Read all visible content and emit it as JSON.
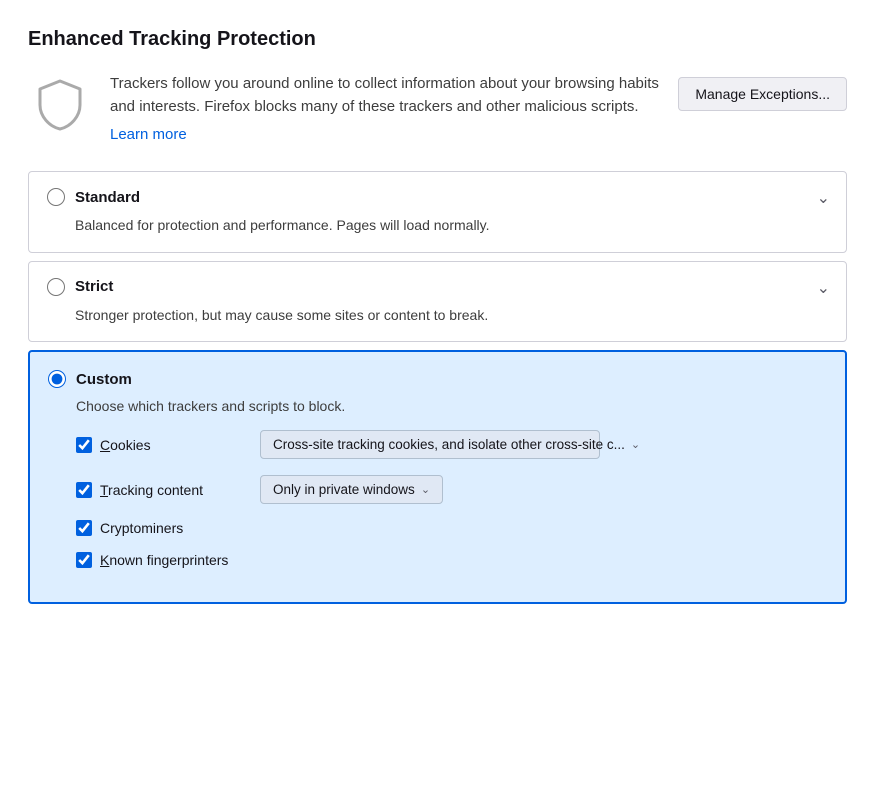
{
  "page": {
    "title": "Enhanced Tracking Protection"
  },
  "intro": {
    "description": "Trackers follow you around online to collect information about your browsing habits and interests. Firefox blocks many of these trackers and other malicious scripts.",
    "learn_more_label": "Learn more",
    "manage_btn_label": "Manage Exceptions..."
  },
  "options": [
    {
      "id": "standard",
      "label": "Standard",
      "description": "Balanced for protection and performance. Pages will load normally.",
      "selected": false
    },
    {
      "id": "strict",
      "label": "Strict",
      "description": "Stronger protection, but may cause some sites or content to break.",
      "selected": false
    }
  ],
  "custom": {
    "label": "Custom",
    "selected": true,
    "description": "Choose which trackers and scripts to block.",
    "rows": [
      {
        "id": "cookies",
        "label": "Cookies",
        "checked": true,
        "dropdown_label": "Cross-site tracking cookies, and isolate other cross-site c...",
        "has_dropdown": true,
        "underline_char": "C"
      },
      {
        "id": "tracking_content",
        "label": "Tracking content",
        "checked": true,
        "dropdown_label": "Only in private windows",
        "has_dropdown": true,
        "underline_char": "T"
      },
      {
        "id": "cryptominers",
        "label": "Cryptominers",
        "checked": true,
        "has_dropdown": false
      },
      {
        "id": "known_fingerprinters",
        "label": "Known fingerprinters",
        "checked": true,
        "has_dropdown": false
      }
    ]
  },
  "icons": {
    "chevron_down": "∨",
    "shield": "shield"
  }
}
